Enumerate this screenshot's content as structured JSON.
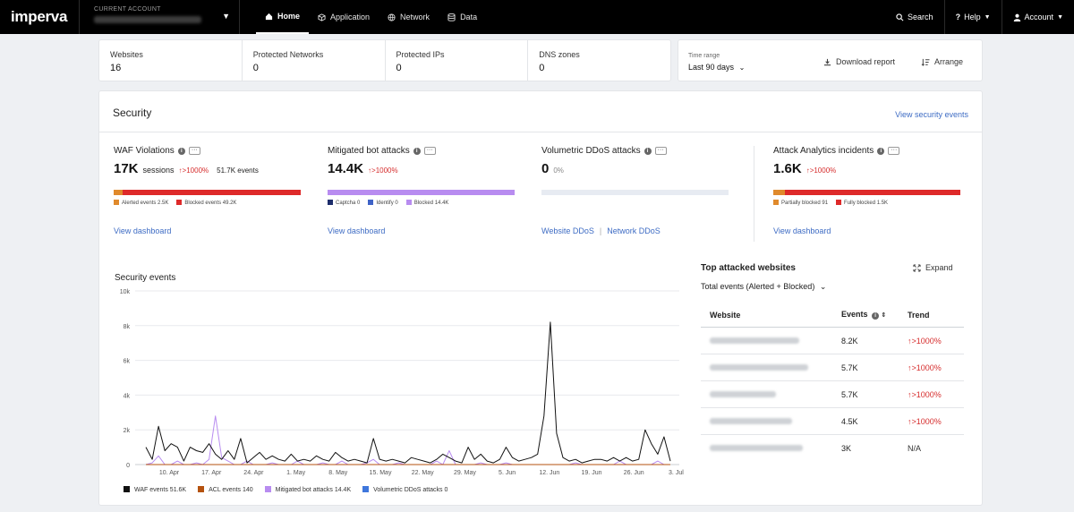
{
  "brand": {
    "logo": "imperva"
  },
  "account": {
    "label": "CURRENT ACCOUNT"
  },
  "nav": {
    "tabs": [
      {
        "label": "Home",
        "icon": "home-icon"
      },
      {
        "label": "Application",
        "icon": "cube-icon"
      },
      {
        "label": "Network",
        "icon": "globe-icon"
      },
      {
        "label": "Data",
        "icon": "database-icon"
      }
    ],
    "search": "Search",
    "help": "Help",
    "account": "Account"
  },
  "stats": [
    {
      "label": "Websites",
      "value": "16"
    },
    {
      "label": "Protected Networks",
      "value": "0"
    },
    {
      "label": "Protected IPs",
      "value": "0"
    },
    {
      "label": "DNS zones",
      "value": "0"
    }
  ],
  "time_range": {
    "label": "Time range",
    "value": "Last 90 days"
  },
  "actions": {
    "download": "Download report",
    "arrange": "Arrange"
  },
  "security": {
    "title": "Security",
    "view_events": "View security events",
    "cards": {
      "waf": {
        "title": "WAF Violations",
        "big": "17K",
        "unit": "sessions",
        "trend": "↑>1000%",
        "extra": "51.7K events",
        "legend": [
          "Alerted events 2.5K",
          "Blocked events 49.2K"
        ],
        "link": "View dashboard",
        "bar_fractions": [
          0.05,
          0.95
        ],
        "bar_colors": [
          "#e08a2c",
          "#de2a2a"
        ]
      },
      "bot": {
        "title": "Mitigated bot attacks",
        "big": "14.4K",
        "trend": "↑>1000%",
        "legend": [
          "Captcha 0",
          "Identify 0",
          "Blocked 14.4K"
        ],
        "link": "View dashboard",
        "bar_fractions": [
          1.0
        ],
        "bar_colors": [
          "#b88cf0"
        ],
        "legend_colors": [
          "#1d2d6b",
          "#3f63c7",
          "#b88cf0"
        ]
      },
      "ddos": {
        "title": "Volumetric DDoS attacks",
        "big": "0",
        "pct": "0%",
        "links": [
          "Website DDoS",
          "Network DDoS"
        ]
      },
      "analytics": {
        "title": "Attack Analytics incidents",
        "big": "1.6K",
        "trend": "↑>1000%",
        "legend": [
          "Partially blocked 91",
          "Fully blocked 1.5K"
        ],
        "link": "View dashboard",
        "bar_fractions": [
          0.06,
          0.94
        ],
        "bar_colors": [
          "#e08a2c",
          "#de2a2a"
        ]
      }
    }
  },
  "chart_data": {
    "type": "line",
    "title": "Security events",
    "x_ticks": [
      "10. Apr",
      "17. Apr",
      "24. Apr",
      "1. May",
      "8. May",
      "15. May",
      "22. May",
      "29. May",
      "5. Jun",
      "12. Jun",
      "19. Jun",
      "26. Jun",
      "3. Jul"
    ],
    "y_ticks": [
      "10k",
      "8k",
      "6k",
      "4k",
      "2k",
      "0"
    ],
    "ylim": [
      0,
      10000
    ],
    "series": [
      {
        "name": "WAF events",
        "legend_value": "51.6K",
        "color": "#111111",
        "values": [
          1000,
          300,
          2200,
          800,
          1200,
          1000,
          200,
          1000,
          800,
          700,
          1200,
          600,
          300,
          800,
          300,
          1500,
          100,
          400,
          700,
          300,
          500,
          300,
          200,
          600,
          200,
          300,
          200,
          500,
          300,
          200,
          700,
          400,
          200,
          300,
          200,
          100,
          1500,
          300,
          200,
          300,
          200,
          100,
          400,
          300,
          200,
          100,
          300,
          600,
          400,
          200,
          100,
          1000,
          300,
          600,
          200,
          100,
          300,
          1000,
          400,
          200,
          300,
          400,
          600,
          2800,
          8200,
          1800,
          400,
          200,
          300,
          100,
          200,
          300,
          300,
          200,
          400,
          200,
          400,
          200,
          300,
          2000,
          1200,
          600,
          1600,
          200
        ]
      },
      {
        "name": "ACL events",
        "legend_value": "140",
        "color": "#b5520f",
        "values": [
          0,
          0,
          0,
          0,
          0,
          0,
          0,
          0,
          0,
          0,
          0,
          0,
          0,
          0,
          0,
          0,
          0,
          0,
          0,
          0,
          0,
          0,
          0,
          0,
          0,
          0,
          0,
          0,
          0,
          0,
          0,
          0,
          0,
          0,
          0,
          0,
          0,
          0,
          0,
          0,
          0,
          0,
          0,
          0,
          0,
          0,
          0,
          0,
          0,
          0,
          0,
          0,
          0,
          0,
          0,
          0,
          0,
          0,
          0,
          0,
          0,
          0,
          0,
          0,
          0,
          0,
          0,
          0,
          0,
          0,
          0,
          0,
          0,
          0,
          0,
          0,
          0,
          0,
          0,
          0,
          0,
          0,
          0,
          0
        ]
      },
      {
        "name": "Mitigated bot attacks",
        "legend_value": "14.4K",
        "color": "#b88cf0",
        "values": [
          0,
          100,
          500,
          0,
          0,
          200,
          0,
          0,
          100,
          0,
          300,
          2800,
          400,
          200,
          0,
          0,
          200,
          0,
          0,
          0,
          100,
          0,
          0,
          0,
          200,
          0,
          0,
          0,
          100,
          0,
          0,
          200,
          0,
          0,
          0,
          100,
          300,
          0,
          0,
          0,
          100,
          0,
          0,
          0,
          0,
          0,
          200,
          0,
          800,
          0,
          0,
          0,
          0,
          100,
          0,
          0,
          0,
          100,
          0,
          0,
          0,
          0,
          0,
          0,
          0,
          0,
          0,
          0,
          100,
          0,
          0,
          0,
          0,
          0,
          0,
          200,
          0,
          0,
          0,
          0,
          0,
          200,
          0,
          0
        ]
      },
      {
        "name": "Volumetric DDoS attacks",
        "legend_value": "0",
        "color": "#3f77dc",
        "values": [
          0,
          0,
          0,
          0,
          0,
          0,
          0,
          0,
          0,
          0,
          0,
          0,
          0,
          0,
          0,
          0,
          0,
          0,
          0,
          0,
          0,
          0,
          0,
          0,
          0,
          0,
          0,
          0,
          0,
          0,
          0,
          0,
          0,
          0,
          0,
          0,
          0,
          0,
          0,
          0,
          0,
          0,
          0,
          0,
          0,
          0,
          0,
          0,
          0,
          0,
          0,
          0,
          0,
          0,
          0,
          0,
          0,
          0,
          0,
          0,
          0,
          0,
          0,
          0,
          0,
          0,
          0,
          0,
          0,
          0,
          0,
          0,
          0,
          0,
          0,
          0,
          0,
          0,
          0,
          0,
          0,
          0,
          0,
          0
        ]
      }
    ]
  },
  "top_attacked": {
    "title": "Top attacked websites",
    "expand": "Expand",
    "filter": "Total events (Alerted + Blocked)",
    "columns": [
      "Website",
      "Events",
      "Trend"
    ],
    "rows": [
      {
        "events": "8.2K",
        "trend": "↑>1000%"
      },
      {
        "events": "5.7K",
        "trend": "↑>1000%"
      },
      {
        "events": "5.7K",
        "trend": "↑>1000%"
      },
      {
        "events": "4.5K",
        "trend": "↑>1000%"
      },
      {
        "events": "3K",
        "trend": "N/A"
      }
    ]
  }
}
